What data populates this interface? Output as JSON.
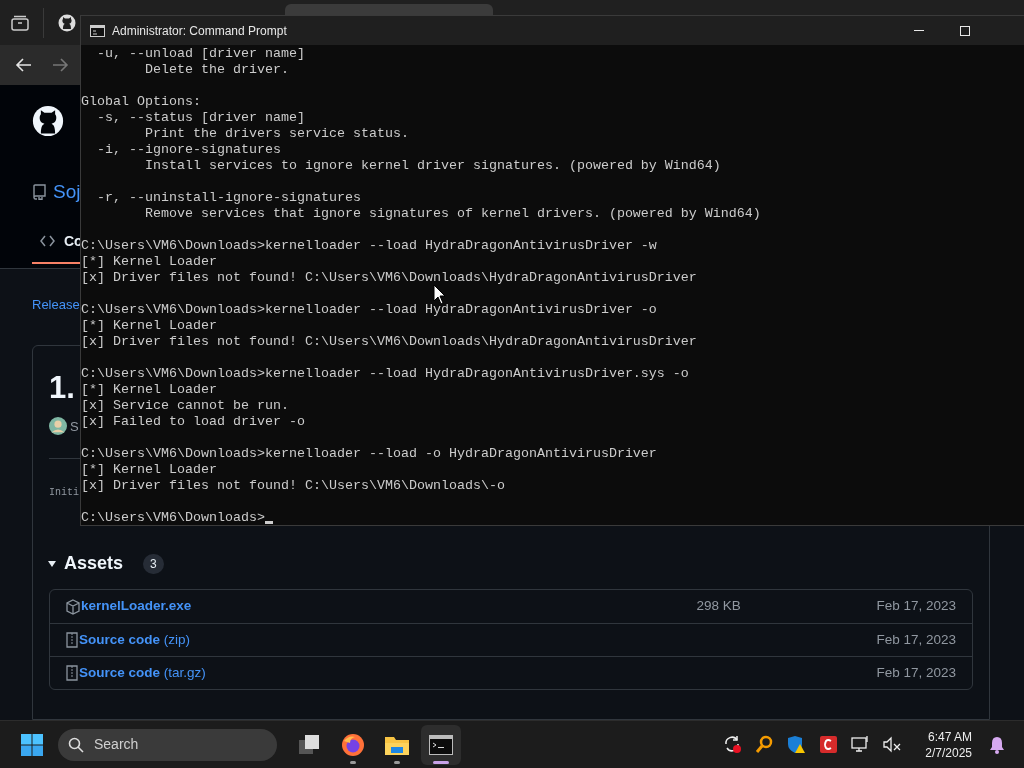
{
  "browser": {
    "repo_name": "Soj",
    "code_tab": {
      "label": "Co",
      "selected": true
    },
    "releases_link": "Release",
    "release": {
      "title": "1.",
      "author": "S",
      "description": "Initi"
    },
    "assets": {
      "title": "Assets",
      "expanded": true,
      "count": "3",
      "items": [
        {
          "kind": "package",
          "name": "kernelLoader.exe",
          "size": "298 KB",
          "date": "Feb 17, 2023"
        },
        {
          "kind": "archive",
          "name": "Source code",
          "ext": "(zip)",
          "date": "Feb 17, 2023"
        },
        {
          "kind": "archive",
          "name": "Source code",
          "ext": "(tar.gz)",
          "date": "Feb 17, 2023"
        }
      ]
    }
  },
  "terminal": {
    "title": "Administrator: Command Prompt",
    "cursor_visible": true,
    "blocks": [
      [
        "  -u, --unload [driver name]",
        "        Delete the driver."
      ],
      [
        "Global Options:",
        "  -s, --status [driver name]",
        "        Print the drivers service status.",
        "  -i, --ignore-signatures",
        "        Install services to ignore kernel driver signatures. (powered by Wind64)"
      ],
      [
        "  -r, --uninstall-ignore-signatures",
        "        Remove services that ignore signatures of kernel drivers. (powered by Wind64)"
      ],
      [
        "C:\\Users\\VM6\\Downloads>kernelloader --load HydraDragonAntivirusDriver -w",
        "[*] Kernel Loader",
        "[x] Driver files not found! C:\\Users\\VM6\\Downloads\\HydraDragonAntivirusDriver"
      ],
      [
        "C:\\Users\\VM6\\Downloads>kernelloader --load HydraDragonAntivirusDriver -o",
        "[*] Kernel Loader",
        "[x] Driver files not found! C:\\Users\\VM6\\Downloads\\HydraDragonAntivirusDriver"
      ],
      [
        "C:\\Users\\VM6\\Downloads>kernelloader --load HydraDragonAntivirusDriver.sys -o",
        "[*] Kernel Loader",
        "[x] Service cannot be run.",
        "[x] Failed to load driver -o"
      ],
      [
        "C:\\Users\\VM6\\Downloads>kernelloader --load -o HydraDragonAntivirusDriver",
        "[*] Kernel Loader",
        "[x] Driver files not found! C:\\Users\\VM6\\Downloads\\-o"
      ],
      [
        "C:\\Users\\VM6\\Downloads>"
      ]
    ]
  },
  "taskbar": {
    "search_placeholder": "Search",
    "apps": [
      {
        "kind": "task-view",
        "selected": false
      },
      {
        "kind": "firefox",
        "selected": false
      },
      {
        "kind": "explorer",
        "selected": false
      },
      {
        "kind": "terminal",
        "selected": true
      }
    ],
    "time": "6:47 AM",
    "date": "2/7/2025"
  }
}
